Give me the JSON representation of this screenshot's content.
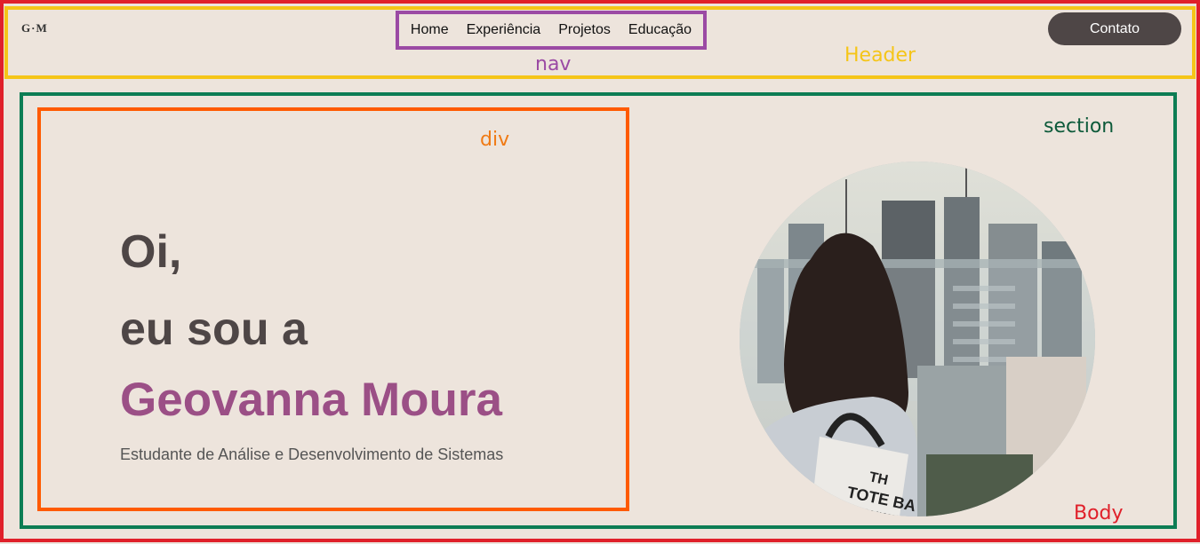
{
  "annotations": {
    "nav": "nav",
    "header": "Header",
    "div": "div",
    "section": "section",
    "body": "Body"
  },
  "header": {
    "logo": "G·M",
    "nav": [
      "Home",
      "Experiência",
      "Projetos",
      "Educação"
    ],
    "contact_label": "Contato"
  },
  "hero": {
    "line1": "Oi,",
    "line2": "eu sou a",
    "name": "Geovanna Moura",
    "subtitle": "Estudante de Análise e Desenvolvimento de Sistemas",
    "photo_bag_text": [
      "TH",
      "TOTE BA",
      "MARC JACOBS"
    ]
  },
  "colors": {
    "background": "#ede4dc",
    "accent_name": "#9b4f86",
    "text_dark": "#4e4646",
    "button": "#4e4646"
  }
}
